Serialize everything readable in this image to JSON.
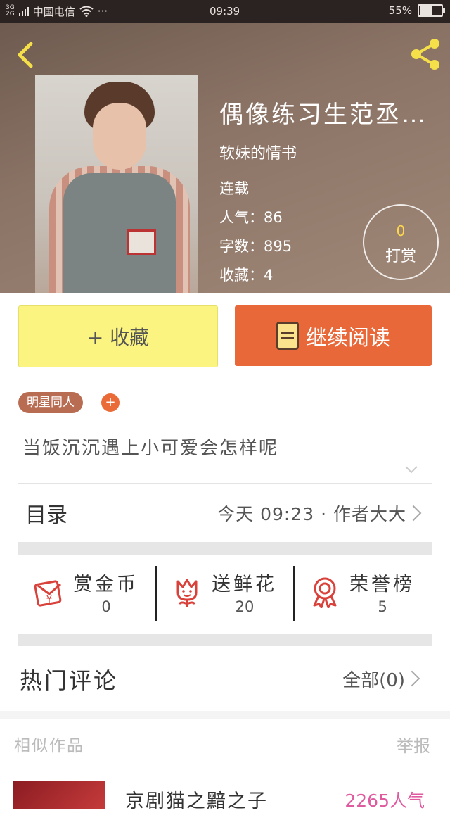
{
  "status_bar": {
    "carrier": "中国电信",
    "network_top": "3G",
    "network_bottom": "2G",
    "more": "···",
    "time": "09:39",
    "battery": "55%",
    "battery_level": 0.55
  },
  "book": {
    "title": "偶像练习生范丞…",
    "author": "软妹的情书",
    "status": "连载",
    "popularity_label": "人气：",
    "popularity": "86",
    "words_label": "字数：",
    "words": "895",
    "favorites_label": "收藏：",
    "favorites": "4",
    "tip_count": "0",
    "tip_label": "打赏"
  },
  "actions": {
    "favorite_label": "+ 收藏",
    "read_label": "继续阅读"
  },
  "tags": {
    "tag": "明星同人",
    "add": "+"
  },
  "description": "当饭沉沉遇上小可爱会怎样呢",
  "catalog": {
    "label": "目录",
    "info": "今天 09:23 · 作者大大"
  },
  "gifts": [
    {
      "label": "赏金币",
      "value": "0",
      "icon": "red-envelope-icon"
    },
    {
      "label": "送鲜花",
      "value": "20",
      "icon": "flower-icon"
    },
    {
      "label": "荣誉榜",
      "value": "5",
      "icon": "medal-icon"
    }
  ],
  "comments": {
    "title": "热门评论",
    "all_label": "全部(0)"
  },
  "similar": {
    "title": "相似作品",
    "report": "举报",
    "item_title": "京剧猫之黯之子",
    "item_pop": "2265人气"
  },
  "colors": {
    "accent": "#e9683a",
    "fav_bg": "#fbf481",
    "tag_bg": "#b86c52",
    "pop": "#e05aa0",
    "icon_red": "#d9413b"
  }
}
